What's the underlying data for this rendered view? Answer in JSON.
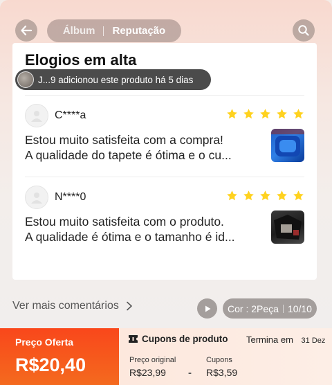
{
  "header": {
    "tabs": [
      {
        "label": "Álbum",
        "active": false
      },
      {
        "label": "Reputação",
        "active": true
      }
    ]
  },
  "card": {
    "title": "Elogios em alta",
    "toast": "J...9 adicionou este produto há 5 dias"
  },
  "reviews": [
    {
      "user": "C****a",
      "rating": 5,
      "text_line1": "Estou muito satisfeita com a compra!",
      "text_line2": "A qualidade do tapete é ótima e o cu..."
    },
    {
      "user": "N****0",
      "rating": 5,
      "text_line1": "Estou muito satisfeita com o produto.",
      "text_line2": "A qualidade é ótima e o tamanho é id..."
    }
  ],
  "footer_actions": {
    "more_comments": "Ver mais comentários",
    "variant": "Cor : 2Peça",
    "counter": "10/10"
  },
  "price_bar": {
    "offer_label": "Preço Oferta",
    "offer_price": "R$20,40",
    "coupons_title": "Cupons de produto",
    "ends_label": "Termina em",
    "ends_date": "31 Dez",
    "original_label": "Preço original",
    "original_value": "R$23,99",
    "minus": "-",
    "coupons_label": "Cupons",
    "coupons_value": "R$3,59"
  },
  "colors": {
    "offer_orange": "#f9471b",
    "star_yellow": "#ffd21f",
    "pill_gray": "#a49e9c"
  },
  "icons": [
    "back-arrow-icon",
    "search-icon",
    "star-icon",
    "chevron-right-icon",
    "play-icon",
    "ticket-icon"
  ]
}
